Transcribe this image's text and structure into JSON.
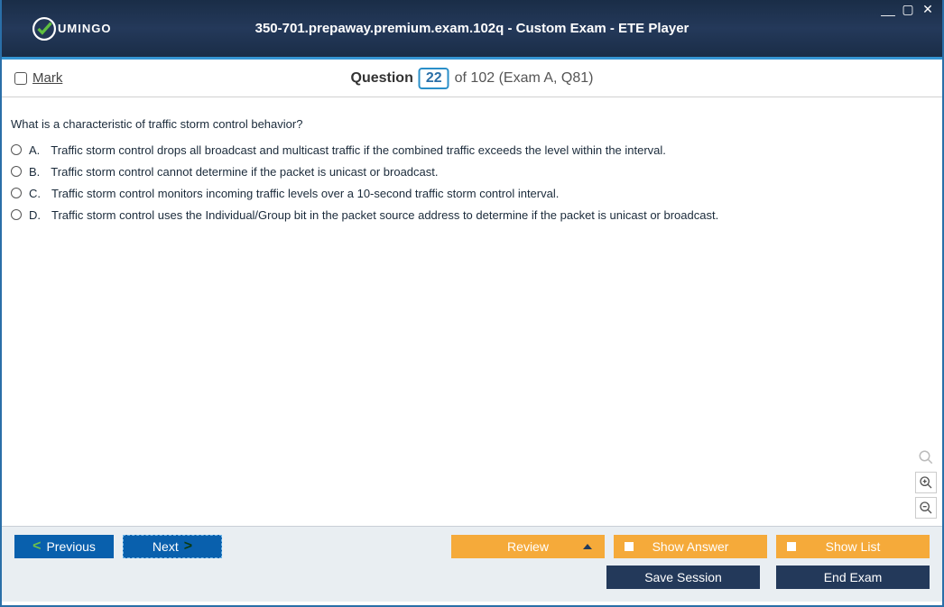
{
  "window": {
    "title": "350-701.prepaway.premium.exam.102q - Custom Exam - ETE Player",
    "brand": "UMINGO"
  },
  "header": {
    "mark_label": "Mark",
    "question_word": "Question",
    "question_number": "22",
    "of_text": "of 102 (Exam A, Q81)"
  },
  "question": {
    "prompt": "What is a characteristic of traffic storm control behavior?",
    "options": [
      {
        "letter": "A.",
        "text": "Traffic storm control drops all broadcast and multicast traffic if the combined traffic exceeds the level within the interval."
      },
      {
        "letter": "B.",
        "text": "Traffic storm control cannot determine if the packet is unicast or broadcast."
      },
      {
        "letter": "C.",
        "text": "Traffic storm control monitors incoming traffic levels over a 10-second traffic storm control interval."
      },
      {
        "letter": "D.",
        "text": "Traffic storm control uses the Individual/Group bit in the packet source address to determine if the packet is unicast or broadcast."
      }
    ]
  },
  "buttons": {
    "previous": "Previous",
    "next": "Next",
    "review": "Review",
    "show_answer": "Show Answer",
    "show_list": "Show List",
    "save_session": "Save Session",
    "end_exam": "End Exam"
  }
}
